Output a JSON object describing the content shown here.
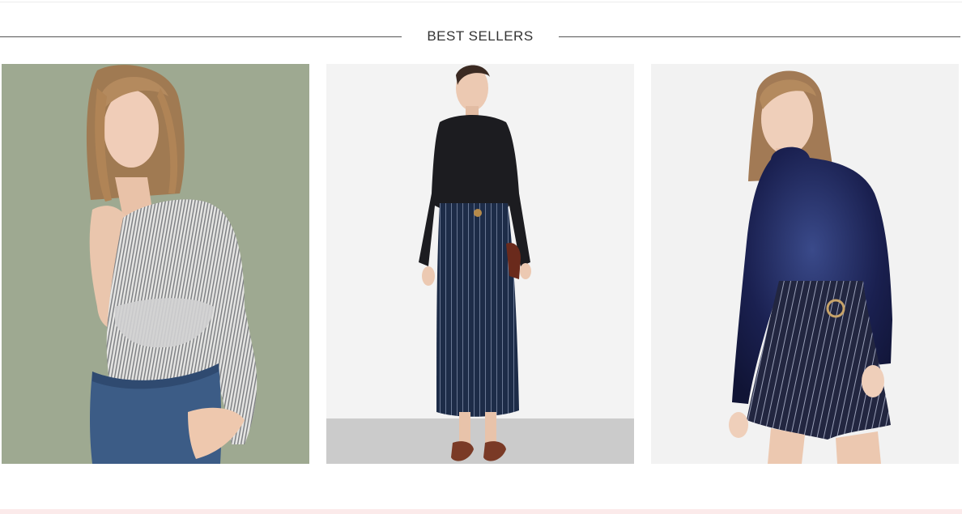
{
  "section": {
    "title": "BEST SELLERS"
  },
  "products": [
    {
      "image_icon": "model-striped-shirt-photo",
      "colors": {
        "background": "#9aa58e",
        "top": "#cfd0cf",
        "bottom": "#3c5c86"
      }
    },
    {
      "image_icon": "model-black-knit-pinstripe-skirt-photo",
      "colors": {
        "background": "#f3f3f3",
        "floor": "#cbcbcb",
        "top": "#1c1c20",
        "bottom": "#1d2c48"
      }
    },
    {
      "image_icon": "model-velvet-top-pinstripe-skort-photo",
      "colors": {
        "background": "#f2f2f2",
        "top": "#1a2050",
        "bottom": "#222640"
      }
    }
  ],
  "colors": {
    "rule": "#555555",
    "footer_band": "#fbeaea"
  }
}
